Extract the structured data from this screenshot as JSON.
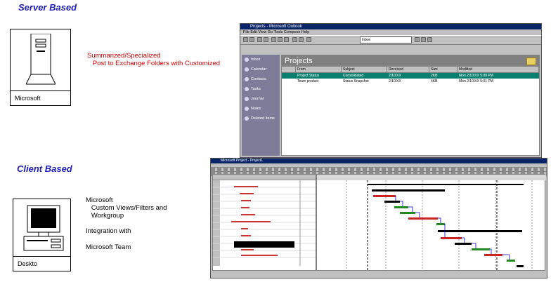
{
  "server_section": {
    "heading": "Server Based",
    "device_caption": "Microsoft",
    "description_line1": "Summarized/Specialized",
    "description_line2": "   Post to Exchange Folders with Customized"
  },
  "client_section": {
    "heading": "Client Based",
    "device_caption": "Deskto",
    "desc1_line1": "Microsoft",
    "desc1_line2": "   Custom Views/Filters and",
    "desc1_line3": "   Workgroup",
    "desc2": "Integration with",
    "desc3": "Microsoft Team"
  },
  "outlook_window": {
    "title": "Projects - Microsoft Outlook",
    "menu": "File   Edit   View   Go   Tools   Compose   Help",
    "address": "Inbox",
    "folder_title": "Projects",
    "sidebar_items": [
      "Inbox",
      "Calendar",
      "Contacts",
      "Tasks",
      "Journal",
      "Notes",
      "Deleted Items"
    ],
    "columns": [
      "From",
      "Subject",
      "Received",
      "Size",
      "Modified"
    ],
    "rows": [
      [
        "Project Status",
        "Consolidated",
        "2/10/XX",
        "2KB",
        "Mon 2/10/XX 5:00 PM"
      ],
      [
        "Team product",
        "Status Snapshot",
        "2/10/XX",
        "4KB",
        "Mon 2/10/XX 5:01 PM"
      ]
    ]
  },
  "project_window": {
    "title": "Microsoft Project - Project1"
  },
  "colors": {
    "heading": "#1f1fb4",
    "red_text": "#cc0000",
    "outlook_title": "#0a246a",
    "selection": "#0a7f70"
  }
}
